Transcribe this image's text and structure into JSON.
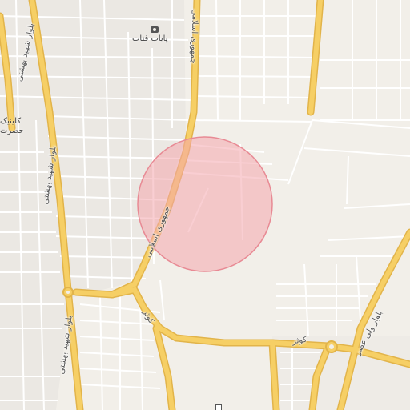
{
  "map": {
    "labels": {
      "payab_qanat": "پایاب قنات",
      "jomhouri_top": "جمهوری اسلامی",
      "jomhouri_mid": "جمهوری اسلامی",
      "shahid_beheshti_1": "بلوار شهید بهشتی",
      "shahid_beheshti_2": "بلوار شهید بهشتی",
      "shahid_beheshti_3": "بلوار شهید بهشتی",
      "clinic_line1": "کلینیک",
      "clinic_line2": "حضرت",
      "kowsar_1": "کوثر",
      "kowsar_2": "کوثر",
      "vali_asr": "بلوار ولی عصر"
    },
    "colors": {
      "background": "#f2efe9",
      "road_main": "#f6cf65",
      "road_casing": "#e2b44a",
      "road_minor": "#ffffff",
      "highlight_fill": "#f4a6ad",
      "highlight_stroke": "#e88a94"
    },
    "icons": {
      "poi_top": "camera-icon",
      "poi_bottom": "building-icon"
    }
  }
}
